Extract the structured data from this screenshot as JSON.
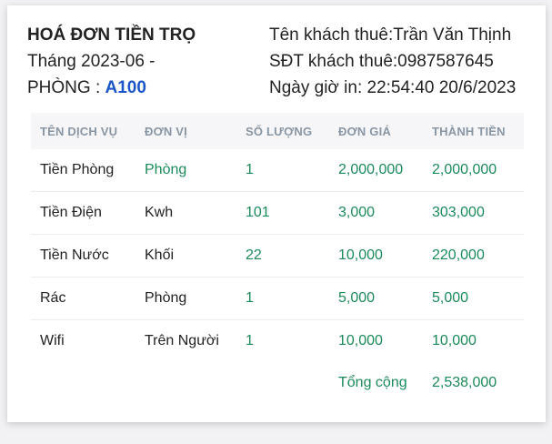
{
  "header": {
    "title": "HOÁ ĐƠN TIỀN TRỌ",
    "month": "Tháng 2023-06 -",
    "room_label": "PHÒNG : ",
    "room_value": "A100",
    "tenant": "Tên khách thuê:Trần Văn Thịnh",
    "phone": "SĐT khách thuê:0987587645",
    "printed_at": "Ngày giờ in: 22:54:40 20/6/2023"
  },
  "table": {
    "columns": [
      "TÊN DỊCH VỤ",
      "ĐƠN VỊ",
      "SỐ LƯỢNG",
      "ĐƠN GIÁ",
      "THÀNH TIỀN"
    ],
    "rows": [
      {
        "name": "Tiền Phòng",
        "unit": "Phòng",
        "unit_color": "green",
        "qty": "1",
        "price": "2,000,000",
        "total": "2,000,000"
      },
      {
        "name": "Tiền Điện",
        "unit": "Kwh",
        "unit_color": "dark",
        "qty": "101",
        "price": "3,000",
        "total": "303,000"
      },
      {
        "name": "Tiền Nước",
        "unit": "Khối",
        "unit_color": "dark",
        "qty": "22",
        "price": "10,000",
        "total": "220,000"
      },
      {
        "name": "Rác",
        "unit": "Phòng",
        "unit_color": "dark",
        "qty": "1",
        "price": "5,000",
        "total": "5,000"
      },
      {
        "name": "Wifi",
        "unit": "Trên Người",
        "unit_color": "dark",
        "qty": "1",
        "price": "10,000",
        "total": "10,000"
      }
    ],
    "sum_label": "Tổng cộng",
    "sum_value": "2,538,000"
  },
  "colors": {
    "accent_green": "#1b8a5a",
    "room_blue": "#1a56c8",
    "header_gray": "#8a96a3"
  }
}
